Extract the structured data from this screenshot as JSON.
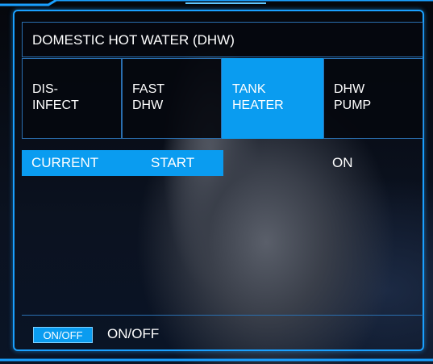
{
  "header": {
    "title": "DOMESTIC HOT WATER  (DHW)"
  },
  "tiles": [
    {
      "line1": "DIS-",
      "line2": "INFECT",
      "active": false
    },
    {
      "line1": "FAST",
      "line2": "DHW",
      "active": false
    },
    {
      "line1": "TANK",
      "line2": "HEATER",
      "active": true
    },
    {
      "line1": "DHW",
      "line2": "PUMP",
      "active": false
    }
  ],
  "status": {
    "label": "CURRENT",
    "action": "START",
    "value": "ON"
  },
  "footer": {
    "toggle_label": "ON/OFF",
    "toggle_text": "ON/OFF"
  },
  "colors": {
    "accent": "#0a9cf0",
    "frame": "#1aa0ff",
    "border": "#2a6fb0"
  }
}
